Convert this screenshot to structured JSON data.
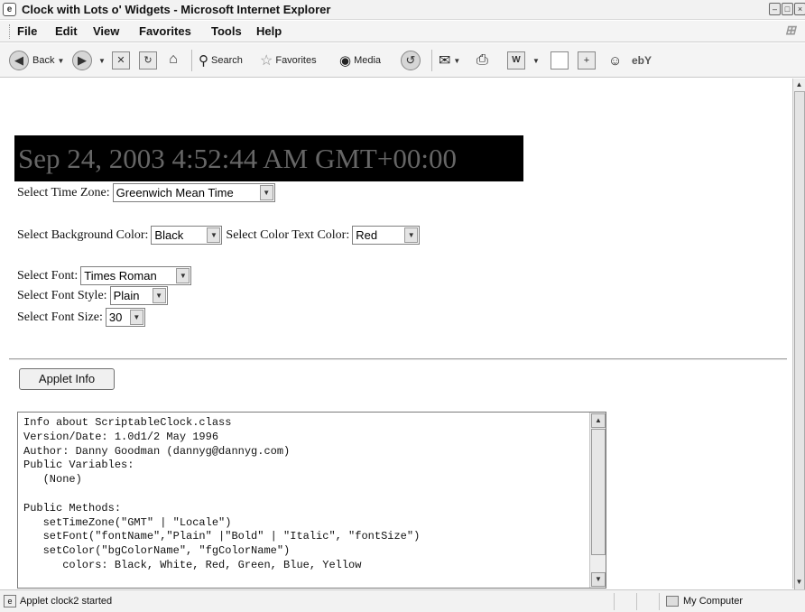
{
  "window": {
    "title": "Clock with Lots o' Widgets - Microsoft Internet Explorer",
    "icon": "ie-icon"
  },
  "menu": [
    "File",
    "Edit",
    "View",
    "Favorites",
    "Tools",
    "Help"
  ],
  "toolbar": {
    "back_label": "Back",
    "search_label": "Search",
    "favorites_label": "Favorites",
    "media_label": "Media"
  },
  "clock": {
    "text": "Sep 24, 2003 4:52:44 AM GMT+00:00",
    "background": "#000000",
    "text_color": "#666666"
  },
  "controls": {
    "timezone": {
      "label": "Select Time Zone:",
      "value": "Greenwich Mean Time"
    },
    "bg_color": {
      "label": "Select Background Color:",
      "value": "Black"
    },
    "text_color": {
      "label": "Select Color Text Color:",
      "value": "Red"
    },
    "font": {
      "label": "Select Font:",
      "value": "Times Roman"
    },
    "font_style": {
      "label": "Select Font Style:",
      "value": "Plain"
    },
    "font_size": {
      "label": "Select Font Size:",
      "value": "30"
    }
  },
  "applet_button": "Applet Info",
  "info_text": "Info about ScriptableClock.class\nVersion/Date: 1.0d1/2 May 1996\nAuthor: Danny Goodman (dannyg@dannyg.com)\nPublic Variables:\n   (None)\n\nPublic Methods:\n   setTimeZone(\"GMT\" | \"Locale\")\n   setFont(\"fontName\",\"Plain\" |\"Bold\" | \"Italic\", \"fontSize\")\n   setColor(\"bgColorName\", \"fgColorName\")\n      colors: Black, White, Red, Green, Blue, Yellow",
  "status": {
    "text": "Applet clock2 started",
    "zone": "My Computer"
  }
}
